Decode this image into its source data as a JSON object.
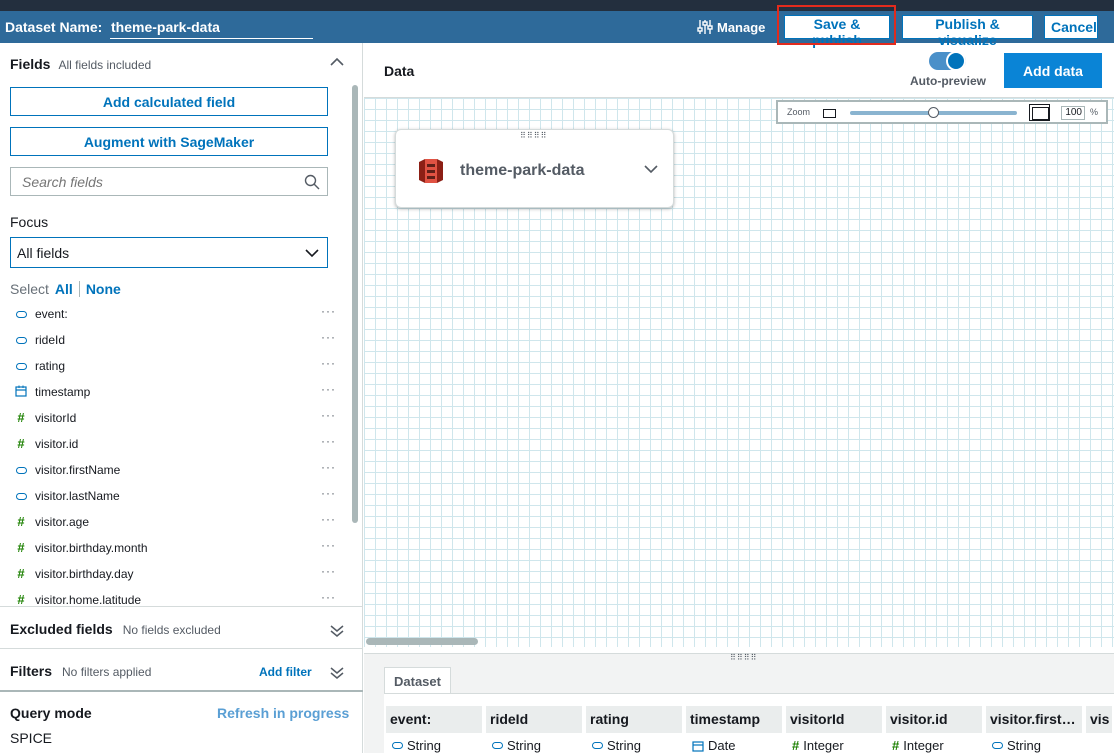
{
  "header": {
    "dataset_label": "Dataset Name:",
    "dataset_name": "theme-park-data",
    "manage": "Manage",
    "save_publish": "Save & publish",
    "publish_visualize": "Publish & visualize",
    "cancel": "Cancel"
  },
  "colors": {
    "header_bg": "#2e6a9a",
    "accent": "#0073bb",
    "highlight": "#e22b1d",
    "numeric": "#1d8102"
  },
  "left": {
    "fields_title": "Fields",
    "fields_sub": "All fields included",
    "add_calc": "Add calculated field",
    "augment": "Augment with SageMaker",
    "search_placeholder": "Search fields",
    "focus_label": "Focus",
    "focus_value": "All fields",
    "select_label": "Select",
    "select_all": "All",
    "select_none": "None",
    "fields": [
      {
        "name": "event:",
        "type": "string"
      },
      {
        "name": "rideId",
        "type": "string"
      },
      {
        "name": "rating",
        "type": "string"
      },
      {
        "name": "timestamp",
        "type": "date"
      },
      {
        "name": "visitorId",
        "type": "integer"
      },
      {
        "name": "visitor.id",
        "type": "integer"
      },
      {
        "name": "visitor.firstName",
        "type": "string"
      },
      {
        "name": "visitor.lastName",
        "type": "string"
      },
      {
        "name": "visitor.age",
        "type": "integer"
      },
      {
        "name": "visitor.birthday.month",
        "type": "integer"
      },
      {
        "name": "visitor.birthday.day",
        "type": "integer"
      },
      {
        "name": "visitor.home.latitude",
        "type": "integer"
      }
    ],
    "field_menu": "···",
    "excluded_title": "Excluded fields",
    "excluded_sub": "No fields excluded",
    "filters_title": "Filters",
    "filters_sub": "No filters applied",
    "add_filter": "Add filter",
    "query_mode": "Query mode",
    "refresh": "Refresh in progress",
    "spice": "SPICE"
  },
  "right": {
    "data_title": "Data",
    "auto_preview": "Auto-preview",
    "add_data": "Add data",
    "zoom_label": "Zoom",
    "zoom_value": "100",
    "zoom_pct": "%",
    "zoom_fraction": 0.5,
    "node_name": "theme-park-data",
    "dataset_tab": "Dataset",
    "columns": [
      {
        "name": "event:",
        "type": "String",
        "icon": "string"
      },
      {
        "name": "rideId",
        "type": "String",
        "icon": "string"
      },
      {
        "name": "rating",
        "type": "String",
        "icon": "string"
      },
      {
        "name": "timestamp",
        "type": "Date",
        "icon": "date"
      },
      {
        "name": "visitorId",
        "type": "Integer",
        "icon": "integer"
      },
      {
        "name": "visitor.id",
        "type": "Integer",
        "icon": "integer"
      },
      {
        "name": "visitor.first…",
        "type": "String",
        "icon": "string"
      },
      {
        "name": "vis",
        "type": "",
        "icon": "string"
      }
    ]
  }
}
